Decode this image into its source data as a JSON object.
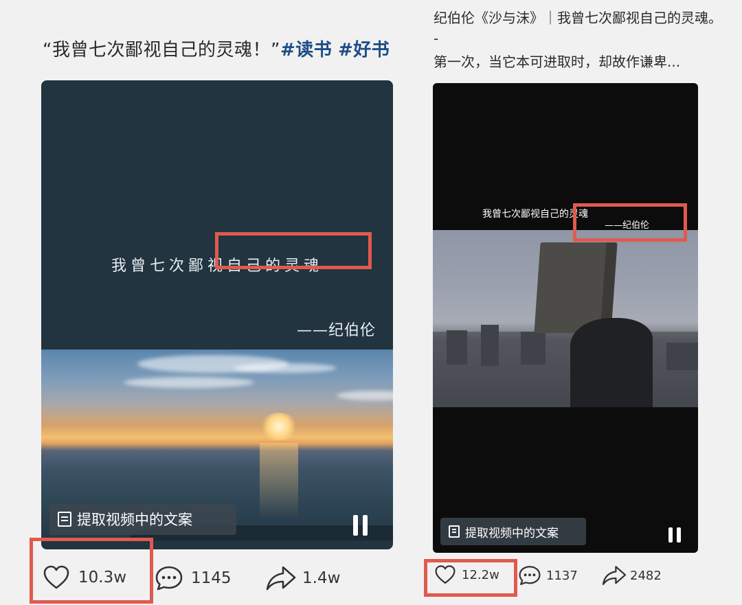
{
  "left_post": {
    "title_main": "“我曾七次鄙视自己的灵魂！”",
    "hashtags": [
      "#读书",
      "#好书"
    ],
    "video_quote": "我曾七次鄙视自己的灵魂",
    "video_author": "——纪伯伦",
    "extract_button": "提取视频中的文案",
    "likes": "10.3w",
    "comments": "1145",
    "shares": "1.4w"
  },
  "right_post": {
    "title": "纪伯伦《沙与沫》｜我曾七次鄙视自己的灵魂。",
    "dash": "-",
    "line": "第一次，当它本可进取时，却故作谦卑...",
    "video_quote": "我曾七次鄙视自己的灵魂",
    "video_author": "——纪伯伦",
    "extract_button": "提取视频中的文案",
    "likes": "12.2w",
    "comments": "1137",
    "shares": "2482"
  },
  "colors": {
    "highlight_box": "#e05a4e",
    "hashtag": "#1e4d86",
    "background": "#f1f1f1"
  },
  "icons": [
    "heart-icon",
    "comment-icon",
    "share-icon",
    "document-icon",
    "pause-icon"
  ]
}
